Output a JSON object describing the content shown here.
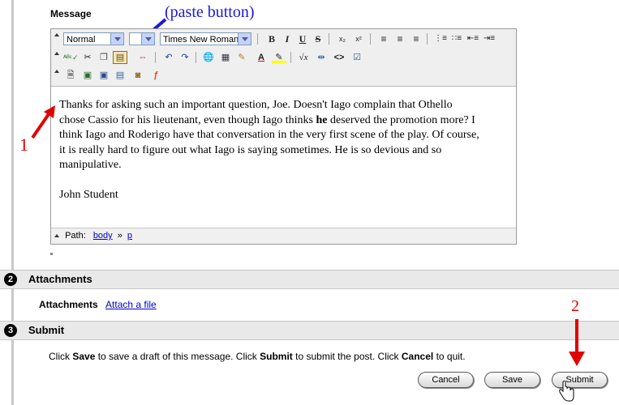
{
  "message_label": "Message",
  "annotations": {
    "paste": "(paste button)",
    "one": "1",
    "two": "2"
  },
  "toolbar": {
    "format_select": "Normal",
    "font_select": "Times New Roman",
    "row1_icons": [
      "bold-icon",
      "italic-icon",
      "underline-icon",
      "strikethrough-icon",
      "subscript-icon",
      "superscript-icon",
      "align-left-icon",
      "align-center-icon",
      "align-right-icon",
      "numbered-list-icon",
      "bullet-list-icon",
      "outdent-icon",
      "indent-icon"
    ],
    "row2_icons": [
      "spellcheck-icon",
      "cut-icon",
      "copy-icon",
      "paste-icon",
      "paste-special-icon",
      "undo-icon",
      "redo-icon",
      "link-icon",
      "table-icon",
      "pencil-icon",
      "font-color-icon",
      "highlight-icon",
      "equation-icon",
      "rule-icon",
      "html-source-icon",
      "edit-note-icon"
    ],
    "row3_icons": [
      "attach-file-icon",
      "insert-image-icon",
      "insert-media-icon",
      "insert-audio-icon",
      "insert-applet-icon",
      "flash-icon"
    ]
  },
  "editor": {
    "paragraph1_a": "Thanks for asking such an important question, Joe.  Doesn't Iago complain that Othello chose Cassio for his lieutenant, even though Iago thinks ",
    "paragraph1_bold": "he",
    "paragraph1_b": " deserved the promotion more?  I think Iago and Roderigo have that conversation in the very first scene of the play.  Of course, it is really hard to figure out what Iago is saying sometimes.  He is so devious and so manipulative.",
    "signature": "John Student",
    "path_label": "Path:",
    "path_body": "body",
    "path_sep": "»",
    "path_p": "p"
  },
  "attachments": {
    "step": "2",
    "title": "Attachments",
    "label": "Attachments",
    "link": "Attach a file"
  },
  "submit": {
    "step": "3",
    "title": "Submit",
    "instr_1": "Click ",
    "instr_save": "Save",
    "instr_2": " to save a draft of this message. Click ",
    "instr_submit": "Submit",
    "instr_3": " to submit the post. Click ",
    "instr_cancel": "Cancel",
    "instr_4": " to quit.",
    "cancel_label": "Cancel",
    "save_label": "Save",
    "submit_label": "Submit"
  },
  "colors": {
    "annotation_blue": "#1a1ad6",
    "annotation_red": "#e00000",
    "link": "#0000cc"
  }
}
